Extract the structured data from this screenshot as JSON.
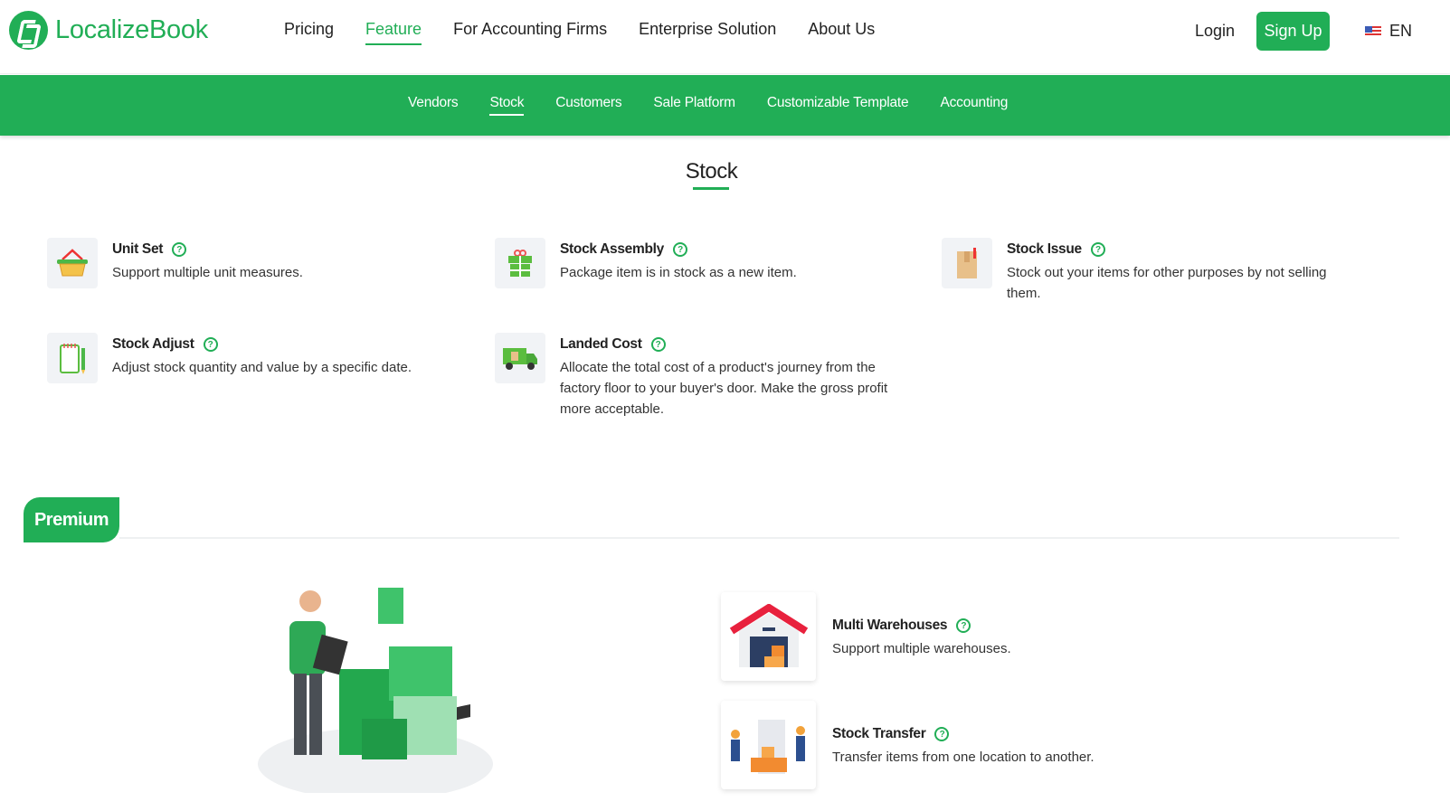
{
  "header": {
    "brand": "LocalizeBook",
    "nav": [
      "Pricing",
      "Feature",
      "For Accounting Firms",
      "Enterprise Solution",
      "About Us"
    ],
    "login": "Login",
    "signup": "Sign Up",
    "lang": "EN"
  },
  "subnav": [
    "Vendors",
    "Stock",
    "Customers",
    "Sale Platform",
    "Customizable Template",
    "Accounting"
  ],
  "section_title": "Stock",
  "help_glyph": "?",
  "features": [
    {
      "name": "Unit Set",
      "desc": "Support multiple unit measures.",
      "icon": "basket-icon"
    },
    {
      "name": "Stock Assembly",
      "desc": "Package item is in stock as a new item.",
      "icon": "gift-icon"
    },
    {
      "name": "Stock Issue",
      "desc": "Stock out your items for other purposes by not selling them.",
      "icon": "box-icon"
    },
    {
      "name": "Stock Adjust",
      "desc": "Adjust stock quantity and value by a specific date.",
      "icon": "notepad-icon"
    },
    {
      "name": "Landed Cost",
      "desc": "Allocate the total cost of a product's journey from the factory floor to your buyer's door. Make the gross profit more acceptable.",
      "icon": "truck-icon"
    }
  ],
  "premium": {
    "label": "Premium",
    "items": [
      {
        "name": "Multi Warehouses",
        "desc": "Support multiple warehouses."
      },
      {
        "name": "Stock Transfer",
        "desc": "Transfer items from one location to another."
      }
    ]
  },
  "colors": {
    "brand": "#21ae56"
  }
}
